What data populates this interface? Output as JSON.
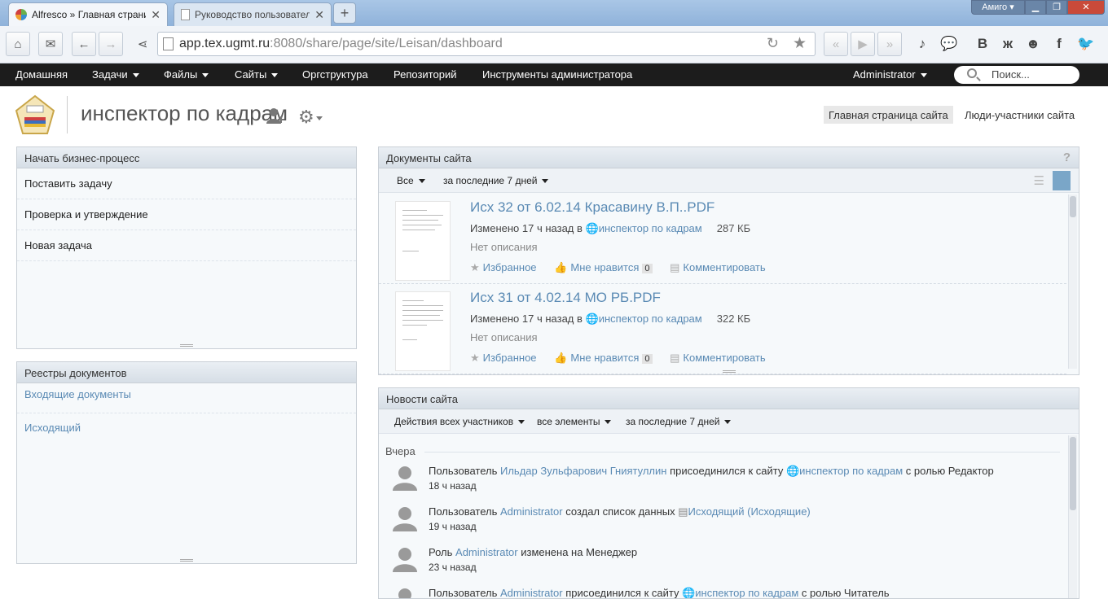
{
  "browser": {
    "tabs": [
      {
        "label": "Alfresco » Главная страниц",
        "active": true
      },
      {
        "label": "Руководство пользователя",
        "active": false
      }
    ],
    "window_label": "Амиго",
    "url_host": "app.tex.ugmt.ru",
    "url_rest": ":8080/share/page/site/Leisan/dashboard"
  },
  "appnav": {
    "items": [
      "Домашняя",
      "Задачи",
      "Файлы",
      "Сайты",
      "Оргструктура",
      "Репозиторий",
      "Инструменты администратора"
    ],
    "user": "Administrator",
    "search_placeholder": "Поиск..."
  },
  "site": {
    "title": "инспектор по кадрам",
    "nav": [
      "Главная страница сайта",
      "Люди-участники сайта"
    ]
  },
  "workflow": {
    "title": "Начать бизнес-процесс",
    "items": [
      "Поставить задачу",
      "Проверка и утверждение",
      "Новая задача"
    ]
  },
  "registers": {
    "title": "Реестры документов",
    "items": [
      "Входящие документы",
      "Исходящий"
    ]
  },
  "documents": {
    "title": "Документы сайта",
    "help": "?",
    "filter_all": "Все",
    "filter_period": "за последние 7 дней",
    "items": [
      {
        "name": "Исх 32 от 6.02.14 Красавину В.П..PDF",
        "modified": "Изменено 17 ч назад в",
        "site": "инспектор по кадрам",
        "size": "287 КБ",
        "desc": "Нет описания",
        "fav": "Избранное",
        "like": "Мне нравится",
        "likes": "0",
        "comment": "Комментировать"
      },
      {
        "name": "Исх 31 от 4.02.14 МО РБ.PDF",
        "modified": "Изменено 17 ч назад в",
        "site": "инспектор по кадрам",
        "size": "322 КБ",
        "desc": "Нет описания",
        "fav": "Избранное",
        "like": "Мне нравится",
        "likes": "0",
        "comment": "Комментировать"
      }
    ]
  },
  "news": {
    "title": "Новости сайта",
    "filters": [
      "Действия всех участников",
      "все элементы",
      "за последние 7 дней"
    ],
    "group": "Вчера",
    "items": [
      {
        "pre": "Пользователь",
        "link1": "Ильдар Зульфарович Гниятуллин",
        "mid": "присоединился к сайту",
        "link2": "инспектор по кадрам",
        "post": "с ролью Редактор",
        "time": "18 ч назад"
      },
      {
        "pre": "Пользователь",
        "link1": "Administrator",
        "mid": "создал список данных",
        "link2": "Исходящий (Исходящие)",
        "post": "",
        "time": "19 ч назад"
      },
      {
        "pre": "Роль",
        "link1": "Administrator",
        "mid": "изменена на Менеджер",
        "link2": "",
        "post": "",
        "time": "23 ч назад"
      },
      {
        "pre": "Пользователь",
        "link1": "Administrator",
        "mid": "присоединился к сайту",
        "link2": "инспектор по кадрам",
        "post": "с ролью Читатель",
        "time": ""
      }
    ]
  }
}
